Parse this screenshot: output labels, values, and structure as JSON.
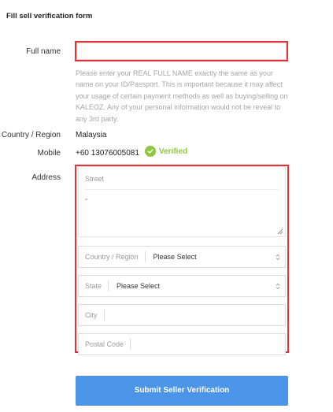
{
  "form": {
    "title": "Fill sell verification form",
    "full_name": {
      "label": "Full name",
      "value": "",
      "help": "Please enter your REAL FULL NAME exactly the same as your name on your ID/Passport. This is important because it may affect your usage of certain payment methods as well as buying/selling on KALEOZ. Any of your personal information would not be reveal to any 3rd party."
    },
    "country": {
      "label": "Country / Region",
      "value": "Malaysia"
    },
    "mobile": {
      "label": "Mobile",
      "value": "+60 13076005081",
      "status": "Verified",
      "status_icon": "check-circle-icon"
    },
    "address": {
      "label": "Address",
      "street_placeholder": "Street",
      "street_value": "-",
      "country_label": "Country / Region",
      "country_value": "Please Select",
      "state_label": "State",
      "state_value": "Please Select",
      "city_label": "City",
      "postal_label": "Postal Code"
    },
    "submit_label": "Submit Seller Verification"
  },
  "colors": {
    "accent": "#4b95e8",
    "verified": "#8ec73f",
    "highlight": "#e53238",
    "help_text": "#a5a5a5"
  }
}
